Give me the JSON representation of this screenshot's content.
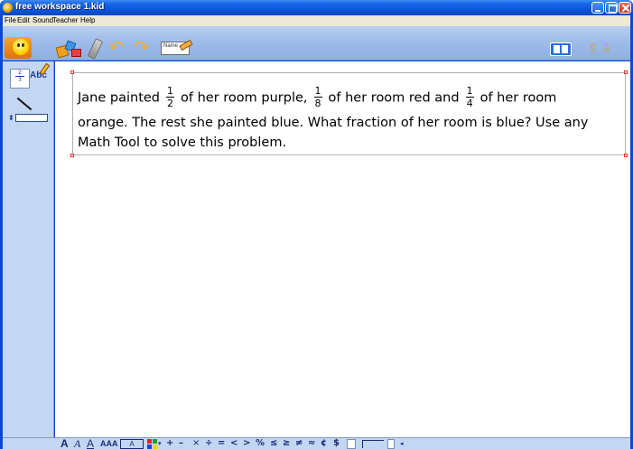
{
  "window": {
    "title": "free workspace 1.kid",
    "controls": {
      "minimize": "minimize-button",
      "maximize": "maximize-button",
      "close": "close-button"
    }
  },
  "menu": [
    "File",
    "Edit",
    "Sound",
    "Teacher",
    "Help"
  ],
  "toolbar": {
    "name_tag_label": "Name",
    "icons": [
      "kidspiration-logo-icon",
      "math-tools-icon",
      "marker-icon",
      "undo-icon",
      "redo-icon",
      "name-tag-icon",
      "page-view-icon",
      "page-up-icon",
      "page-down-icon"
    ]
  },
  "left_palette": {
    "text_tool_label": "Abc",
    "fraction_sample": {
      "numerator": "2",
      "denominator": "3"
    }
  },
  "problem": {
    "line1": {
      "t1": "Jane painted",
      "f1": {
        "num": "1",
        "den": "2"
      },
      "t2": "of her room purple,",
      "f2": {
        "num": "1",
        "den": "8"
      },
      "t3": "of her room red and",
      "f3": {
        "num": "1",
        "den": "4"
      },
      "t4": "of her room"
    },
    "line2": "orange. The rest she painted blue. What fraction of her room is blue? Use any",
    "line3": "Math Tool to solve this problem."
  },
  "format_bar": {
    "bold_a": "A",
    "italic_a": "A",
    "underline_a": "A",
    "size_aaa": "AAA",
    "boxed_a": "A",
    "symbols": {
      "plus": "+",
      "minus": "–",
      "times": "×",
      "divide": "÷",
      "equals": "=",
      "less": "<",
      "greater": ">",
      "percent": "%",
      "le": "≤",
      "ge": "≥",
      "ne": "≠",
      "approx": "≈",
      "cent": "¢",
      "dollar": "$"
    },
    "more": "◂",
    "color_drop": "▾"
  },
  "colors": {
    "titlebar": "#0a53d6",
    "menubar": "#ece9d8",
    "toolbar": "#9dbbe8",
    "palette": "#c4d7f2",
    "selection_handle": "#e03030"
  }
}
